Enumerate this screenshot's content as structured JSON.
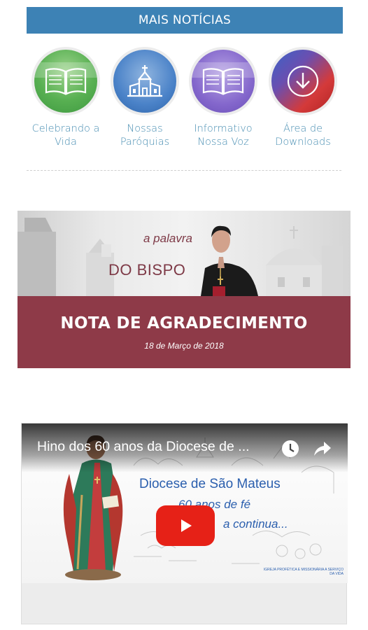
{
  "header": {
    "title": "MAIS NOTÍCIAS"
  },
  "nav_items": [
    {
      "label_line1": "Celebrando a",
      "label_line2": "Vida",
      "icon": "book-icon"
    },
    {
      "label_line1": "Nossas",
      "label_line2": "Paróquias",
      "icon": "church-icon"
    },
    {
      "label_line1": "Informativo",
      "label_line2": "Nossa Voz",
      "icon": "book-icon"
    },
    {
      "label_line1": "Área de",
      "label_line2": "Downloads",
      "icon": "download-icon"
    }
  ],
  "bishop_card": {
    "tagline_small": "a palavra",
    "tagline_big": "DO BISPO",
    "title": "NOTA DE AGRADECIMENTO",
    "date": "18 de Março de 2018"
  },
  "video": {
    "title": "Hino dos 60 anos da Diocese de ...",
    "overlay_line1": "Diocese de São Mateus",
    "overlay_line2": "60 anos de fé",
    "overlay_line3": "a continua...",
    "footer_tag": "IGREJA PROFÉTICA E MISSIONÁRIA A SERVIÇO DA VIDA"
  },
  "colors": {
    "header_bg": "#3d82b5",
    "label_text": "#4a8fb3",
    "bishop_footer_bg": "#8e3a48",
    "play_button": "#e62117"
  }
}
